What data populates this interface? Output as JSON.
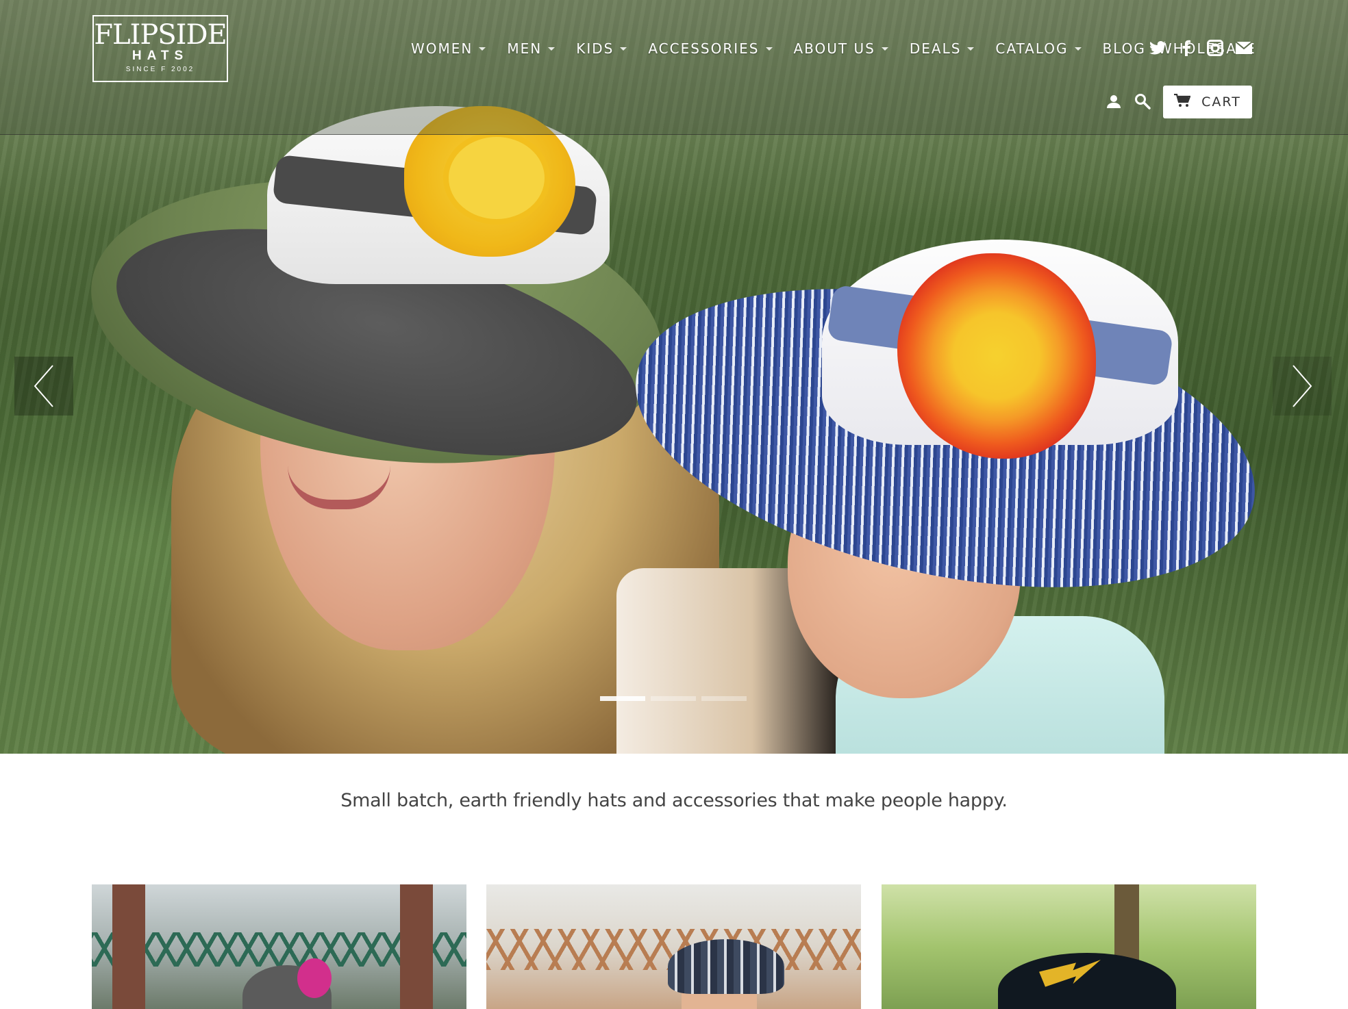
{
  "brand": {
    "logo_main": "FLIPSIDE",
    "logo_sub": "HATS",
    "logo_since": "SINCE F 2002"
  },
  "nav": {
    "items": [
      {
        "label": "WOMEN",
        "dropdown": true
      },
      {
        "label": "MEN",
        "dropdown": true
      },
      {
        "label": "KIDS",
        "dropdown": true
      },
      {
        "label": "ACCESSORIES",
        "dropdown": true
      },
      {
        "label": "ABOUT US",
        "dropdown": true
      },
      {
        "label": "DEALS",
        "dropdown": true
      },
      {
        "label": "CATALOG",
        "dropdown": true
      },
      {
        "label": "BLOG",
        "dropdown": false
      },
      {
        "label": "WHOLESALE",
        "dropdown": false
      }
    ],
    "social_icons": [
      "twitter-icon",
      "facebook-icon",
      "instagram-icon",
      "mail-icon"
    ]
  },
  "utility": {
    "account_icon": "user-icon",
    "search_icon": "search-icon",
    "cart_label": "CART",
    "cart_icon": "cart-icon"
  },
  "slider": {
    "prev_icon": "chevron-left-icon",
    "next_icon": "chevron-right-icon",
    "slide_count": 3,
    "active_index": 0
  },
  "tagline": "Small batch, earth friendly hats and accessories that make people happy.",
  "tiles": [
    {
      "image": "woman in grey cap with pink flower by green bridge"
    },
    {
      "image": "man in plaid newsboy cap by bridge"
    },
    {
      "image": "kid in black cap with yellow lightning bolt"
    }
  ],
  "colors": {
    "nav_text": "#ffffff",
    "tagline_text": "#444444",
    "cart_bg": "#ffffff"
  }
}
